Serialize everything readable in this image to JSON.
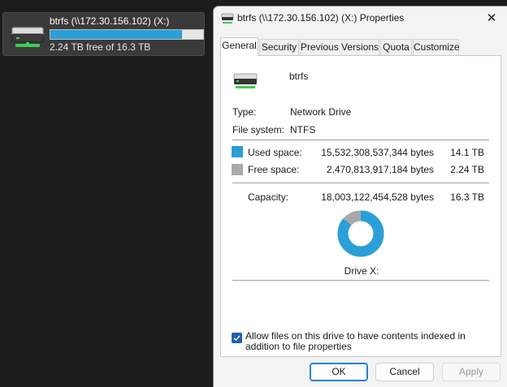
{
  "explorer_tile": {
    "title": "btrfs (\\\\172.30.156.102) (X:)",
    "subtitle": "2.24 TB free of 16.3 TB",
    "used_fraction": 0.862,
    "icon": "network-drive-icon"
  },
  "dialog": {
    "title": "btrfs (\\\\172.30.156.102) (X:) Properties",
    "close_glyph": "✕",
    "tabs": [
      {
        "label": "General",
        "active": true
      },
      {
        "label": "Security",
        "active": false
      },
      {
        "label": "Previous Versions",
        "active": false
      },
      {
        "label": "Quota",
        "active": false
      },
      {
        "label": "Customize",
        "active": false
      }
    ],
    "general": {
      "name_value": "btrfs",
      "type_label": "Type:",
      "type_value": "Network Drive",
      "fs_label": "File system:",
      "fs_value": "NTFS",
      "used_label": "Used space:",
      "used_bytes": "15,532,308,537,344 bytes",
      "used_size": "14.1 TB",
      "free_label": "Free space:",
      "free_bytes": "2,470,813,917,184 bytes",
      "free_size": "2.24 TB",
      "capacity_label": "Capacity:",
      "capacity_bytes": "18,003,122,454,528 bytes",
      "capacity_size": "16.3 TB",
      "drive_caption": "Drive X:",
      "used_fraction": 0.8628,
      "colors": {
        "used": "#2a9fd8",
        "free": "#a9a9a9"
      },
      "index_checkbox_checked": true,
      "index_checkbox_label": "Allow files on this drive to have contents indexed in addition to file properties"
    },
    "buttons": {
      "ok": "OK",
      "cancel": "Cancel",
      "apply": "Apply"
    }
  }
}
